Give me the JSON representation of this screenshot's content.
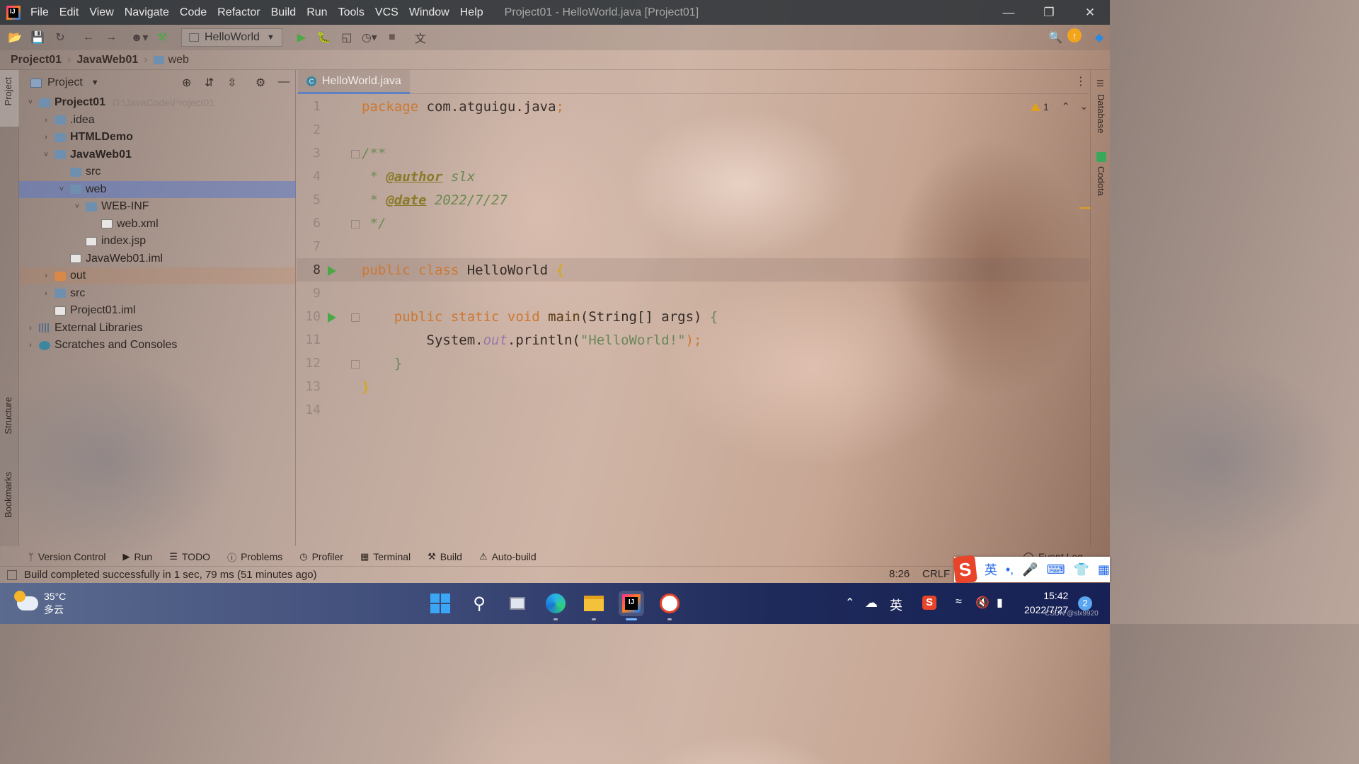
{
  "menubar": {
    "items": [
      "File",
      "Edit",
      "View",
      "Navigate",
      "Code",
      "Refactor",
      "Build",
      "Run",
      "Tools",
      "VCS",
      "Window",
      "Help"
    ],
    "window_title": "Project01 - HelloWorld.java [Project01]"
  },
  "toolbar": {
    "run_config": "HelloWorld"
  },
  "breadcrumb": [
    "Project01",
    "JavaWeb01",
    "web"
  ],
  "left_strip": {
    "tabs": [
      "Project",
      "Structure",
      "Bookmarks"
    ]
  },
  "right_strip": {
    "tabs": [
      "Database",
      "Codota"
    ]
  },
  "project_panel": {
    "title": "Project",
    "tree": [
      {
        "label": "Project01",
        "path": "D:\\JavaCode\\Project01",
        "depth": 0,
        "expanded": true,
        "bold": true
      },
      {
        "label": ".idea",
        "depth": 1,
        "expanded": false
      },
      {
        "label": "HTMLDemo",
        "depth": 1,
        "expanded": false,
        "bold": true
      },
      {
        "label": "JavaWeb01",
        "depth": 1,
        "expanded": true,
        "bold": true
      },
      {
        "label": "src",
        "depth": 2
      },
      {
        "label": "web",
        "depth": 2,
        "expanded": true,
        "selected": true
      },
      {
        "label": "WEB-INF",
        "depth": 3,
        "expanded": true
      },
      {
        "label": "web.xml",
        "depth": 4
      },
      {
        "label": "index.jsp",
        "depth": 3
      },
      {
        "label": "JavaWeb01.iml",
        "depth": 2
      },
      {
        "label": "out",
        "depth": 1,
        "expanded": false
      },
      {
        "label": "src",
        "depth": 1,
        "expanded": false
      },
      {
        "label": "Project01.iml",
        "depth": 1
      },
      {
        "label": "External Libraries",
        "depth": 0,
        "expanded": false
      },
      {
        "label": "Scratches and Consoles",
        "depth": 0,
        "expanded": false
      }
    ]
  },
  "editor": {
    "tab": "HelloWorld.java",
    "current_line": 8,
    "line_numbers": [
      "1",
      "2",
      "3",
      "4",
      "5",
      "6",
      "7",
      "8",
      "9",
      "10",
      "11",
      "12",
      "13",
      "14"
    ],
    "code": {
      "l1_kw": "package",
      "l1_rest": " com.atguigu.java",
      "l1_semi": ";",
      "l3": "/**",
      "l4_star": " * ",
      "l4_tag": "@author",
      "l4_val": " slx",
      "l5_star": " * ",
      "l5_tag": "@date",
      "l5_val": " 2022/7/27",
      "l6": " */",
      "l8_kw": "public class",
      "l8_name": " HelloWorld ",
      "l8_brace": "{",
      "l10_kw": "    public static void",
      "l10_fn": " main",
      "l10_rest": "(String[] args) ",
      "l10_brace": "{",
      "l11_pre": "        System.",
      "l11_out": "out",
      "l11_mid": ".println(",
      "l11_str": "\"HelloWorld!\"",
      "l11_end": ");",
      "l12": "    }",
      "l13": "}"
    },
    "warnings": "1"
  },
  "tool_tabs": [
    "Version Control",
    "Run",
    "TODO",
    "Problems",
    "Profiler",
    "Terminal",
    "Build",
    "Auto-build"
  ],
  "event_log": "Event Log",
  "status": {
    "message": "Build completed successfully in 1 sec, 79 ms (51 minutes ago)",
    "position": "8:26",
    "line_sep": "CRLF"
  },
  "ime": {
    "s": "S",
    "lang": "英"
  },
  "taskbar": {
    "weather_temp": "35°C",
    "weather_desc": "多云",
    "tray_lang": "英",
    "time": "15:42",
    "date": "2022/7/27",
    "notifications": "2"
  },
  "watermark": "CSDN @slx9920"
}
